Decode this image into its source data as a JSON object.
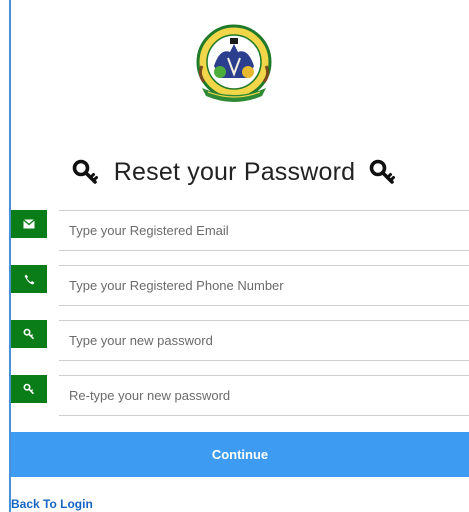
{
  "header": {
    "title": "Reset your Password",
    "logo_icon": "county-coat-of-arms-logo",
    "logo_text": "COUNTY GOVERNMENT OF MAKUENI",
    "title_icon": "key-icon"
  },
  "form": {
    "fields": [
      {
        "icon": "envelope-icon",
        "placeholder": "Type your Registered Email",
        "value": ""
      },
      {
        "icon": "phone-icon",
        "placeholder": "Type your Registered Phone Number",
        "value": ""
      },
      {
        "icon": "key-icon",
        "placeholder": "Type your new password",
        "value": ""
      },
      {
        "icon": "key-icon",
        "placeholder": "Re-type your new password",
        "value": ""
      }
    ],
    "submit_label": "Continue"
  },
  "footer": {
    "back_link": "Back To Login"
  },
  "colors": {
    "addon_green": "#0a7d18",
    "button_blue": "#3d9cf2",
    "link_blue": "#1565c0",
    "left_rule_blue": "#4a90d9"
  }
}
